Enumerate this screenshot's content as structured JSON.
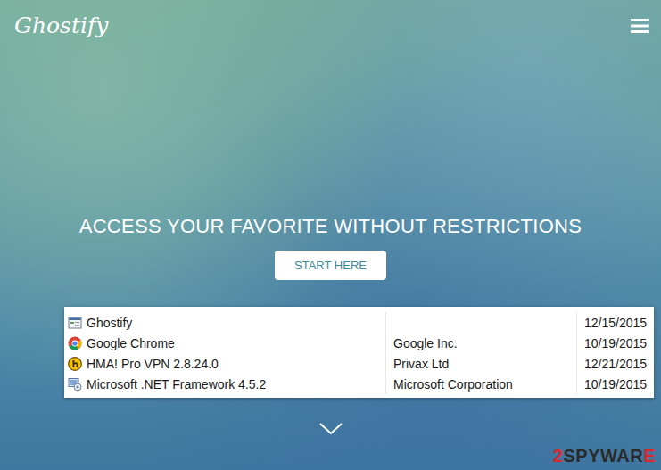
{
  "site": {
    "logo": "Ghostify"
  },
  "hero": {
    "headline": "ACCESS YOUR FAVORITE WITHOUT RESTRICTIONS",
    "button": "START HERE"
  },
  "programs": [
    {
      "kind": "app",
      "name": "Ghostify",
      "publisher": "",
      "date": "12/15/2015"
    },
    {
      "kind": "chrome",
      "name": "Google Chrome",
      "publisher": "Google Inc.",
      "date": "10/19/2015"
    },
    {
      "kind": "hma",
      "name": "HMA! Pro VPN 2.8.24.0",
      "publisher": "Privax Ltd",
      "date": "12/21/2015"
    },
    {
      "kind": "dotnet",
      "name": "Microsoft .NET Framework 4.5.2",
      "publisher": "Microsoft Corporation",
      "date": "10/19/2015"
    }
  ],
  "watermark": [
    "2",
    "SPYWAR",
    "E"
  ]
}
